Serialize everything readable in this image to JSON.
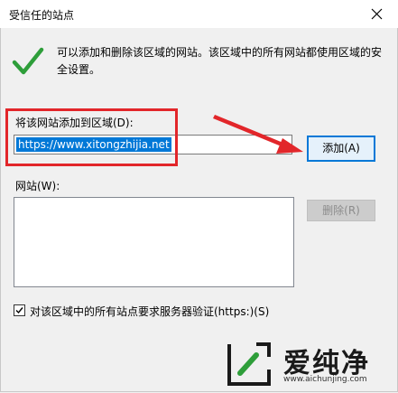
{
  "window": {
    "title": "受信任的站点",
    "close_icon": "close-icon"
  },
  "description": "可以添加和删除该区域的网站。该区域中的所有网站都使用区域的安全设置。",
  "add_zone": {
    "label": "将该网站添加到区域(D):",
    "input_value": "https://www.xitongzhijia.net",
    "add_button_label": "添加(A)"
  },
  "sites": {
    "label": "网站(W):",
    "items": [],
    "remove_button_label": "删除(R)"
  },
  "https_verification": {
    "checked": true,
    "label": "对该区域中的所有站点要求服务器验证(https:)(S)"
  },
  "annotations": {
    "highlight_color": "#e2262a",
    "arrow_color": "#e2262a"
  },
  "watermark": {
    "brand": "爱纯净",
    "url": "www.aichunjing.com"
  },
  "colors": {
    "check_green": "#2e9e3a",
    "selection_blue": "#0078d7"
  }
}
